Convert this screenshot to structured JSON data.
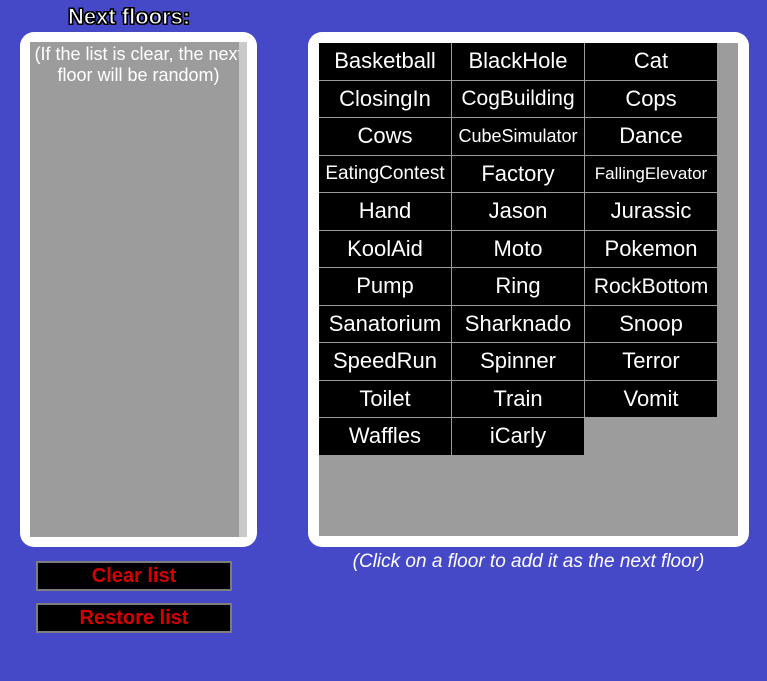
{
  "title": "Next floors:",
  "queue_hint": "(If the list is clear, the next floor will be random)",
  "buttons": {
    "clear": "Clear list",
    "restore": "Restore list"
  },
  "floors": [
    "Basketball",
    "BlackHole",
    "Cat",
    "ClosingIn",
    "CogBuilding",
    "Cops",
    "Cows",
    "CubeSimulator",
    "Dance",
    "EatingContest",
    "Factory",
    "FallingElevator",
    "Hand",
    "Jason",
    "Jurassic",
    "KoolAid",
    "Moto",
    "Pokemon",
    "Pump",
    "Ring",
    "RockBottom",
    "Sanatorium",
    "Sharknado",
    "Snoop",
    "SpeedRun",
    "Spinner",
    "Terror",
    "Toilet",
    "Train",
    "Vomit",
    "Waffles",
    "iCarly"
  ],
  "floor_font_sizes": {
    "CubeSimulator": 18,
    "EatingContest": 19,
    "FallingElevator": 17,
    "RockBottom": 21,
    "CogBuilding": 21
  },
  "bottom_hint": "(Click on a floor to add it as the next floor)"
}
